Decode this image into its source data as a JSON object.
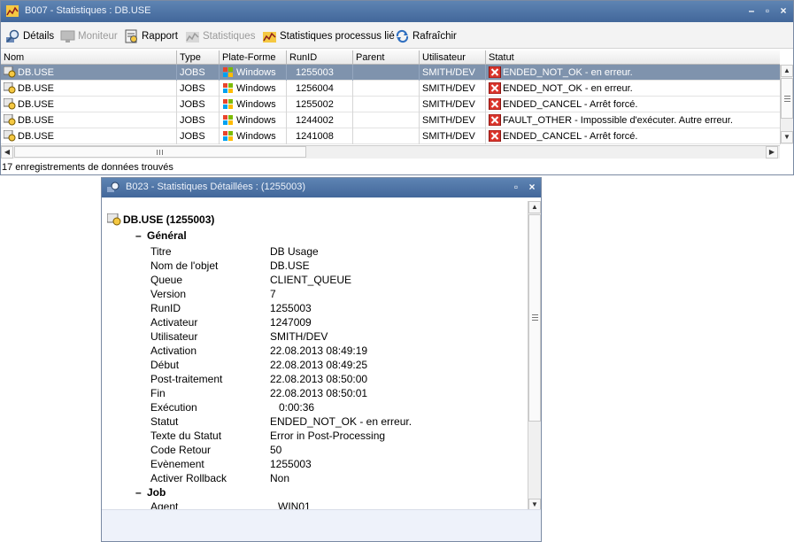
{
  "main_window": {
    "title": "B007 - Statistiques : DB.USE",
    "toolbar": {
      "details": "Détails",
      "monitor": "Moniteur",
      "report": "Rapport",
      "statistics": "Statistiques",
      "linked_stats": "Statistiques processus lié",
      "refresh": "Rafraîchir"
    },
    "columns": [
      "Nom",
      "Type",
      "Plate-Forme",
      "RunID",
      "Parent",
      "Utilisateur",
      "Statut"
    ],
    "rows": [
      {
        "name": "DB.USE",
        "type": "JOBS",
        "platform": "Windows",
        "runid": "1255003",
        "parent": "",
        "user": "SMITH/DEV",
        "status": "ENDED_NOT_OK - en erreur."
      },
      {
        "name": "DB.USE",
        "type": "JOBS",
        "platform": "Windows",
        "runid": "1256004",
        "parent": "",
        "user": "SMITH/DEV",
        "status": "ENDED_NOT_OK - en erreur."
      },
      {
        "name": "DB.USE",
        "type": "JOBS",
        "platform": "Windows",
        "runid": "1255002",
        "parent": "",
        "user": "SMITH/DEV",
        "status": "ENDED_CANCEL - Arrêt forcé."
      },
      {
        "name": "DB.USE",
        "type": "JOBS",
        "platform": "Windows",
        "runid": "1244002",
        "parent": "",
        "user": "SMITH/DEV",
        "status": "FAULT_OTHER - Impossible d'exécuter. Autre erreur."
      },
      {
        "name": "DB.USE",
        "type": "JOBS",
        "platform": "Windows",
        "runid": "1241008",
        "parent": "",
        "user": "SMITH/DEV",
        "status": "ENDED_CANCEL - Arrêt forcé."
      }
    ],
    "status_text": "17 enregistrements de données trouvés"
  },
  "detail_window": {
    "title": "B023 - Statistiques Détaillées : (1255003)",
    "root": "DB.USE (1255003)",
    "section_general": "Général",
    "props": [
      {
        "label": "Titre",
        "value": "DB Usage"
      },
      {
        "label": "Nom de l'objet",
        "value": "DB.USE"
      },
      {
        "label": "Queue",
        "value": "CLIENT_QUEUE"
      },
      {
        "label": "Version",
        "value": "7"
      },
      {
        "label": "RunID",
        "value": "1255003"
      },
      {
        "label": "Activateur",
        "value": "1247009"
      },
      {
        "label": "Utilisateur",
        "value": "SMITH/DEV"
      },
      {
        "label": "Activation",
        "value": "22.08.2013 08:49:19"
      },
      {
        "label": "Début",
        "value": "22.08.2013 08:49:25"
      },
      {
        "label": "Post-traitement",
        "value": "22.08.2013 08:50:00"
      },
      {
        "label": "Fin",
        "value": "22.08.2013 08:50:01"
      },
      {
        "label": "Exécution",
        "value": "   0:00:36"
      },
      {
        "label": "Statut",
        "value": "ENDED_NOT_OK - en erreur."
      },
      {
        "label": "Texte du Statut",
        "value": "Error in Post-Processing"
      },
      {
        "label": "Code Retour",
        "value": "50"
      },
      {
        "label": "Evènement",
        "value": "1255003"
      },
      {
        "label": "Activer Rollback",
        "value": "Non"
      }
    ],
    "section_job": "Job",
    "job_props": [
      {
        "label": "Agent",
        "value": "WIN01"
      }
    ]
  },
  "colors": {
    "titlebar": "#4f75a8",
    "selected_row": "#7f93ad",
    "error_icon": "#d9342b"
  }
}
